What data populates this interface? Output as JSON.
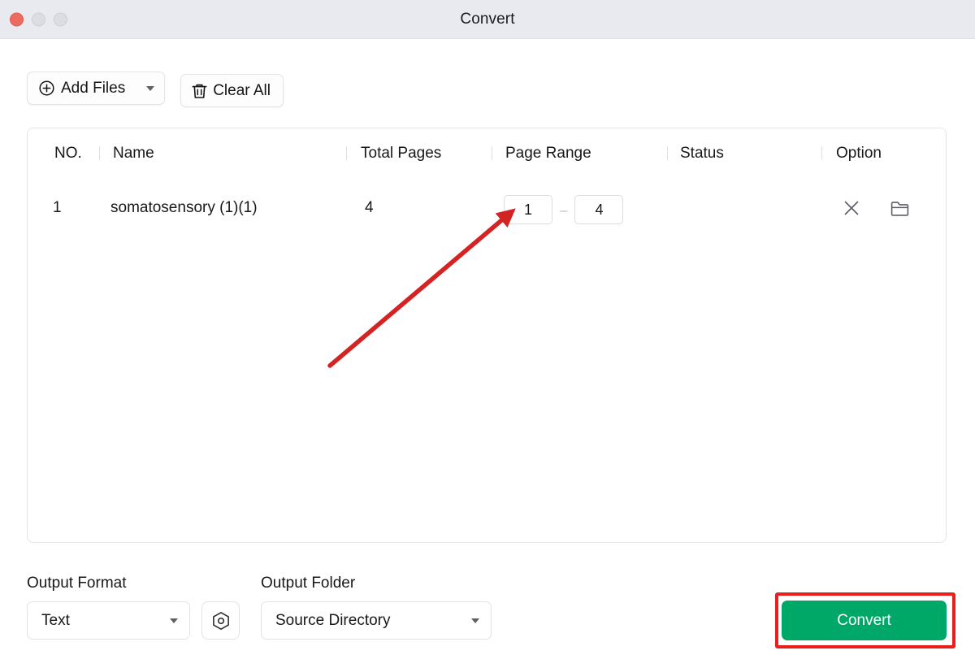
{
  "window": {
    "title": "Convert",
    "traffic_lights": [
      "close",
      "minimize",
      "maximize"
    ]
  },
  "toolbar": {
    "add_files_label": "Add Files",
    "add_files_icon": "plus-circle-icon",
    "add_files_caret": "chevron-down-icon",
    "clear_all_label": "Clear All",
    "clear_all_icon": "trash-icon"
  },
  "file_table": {
    "columns": [
      "NO.",
      "Name",
      "Total Pages",
      "Page Range",
      "Status",
      "Option"
    ],
    "rows": [
      {
        "no": "1",
        "name": "somatosensory (1)(1)",
        "total_pages": "4",
        "page_range_from": "1",
        "page_range_to": "4",
        "page_range_separator": "–",
        "status": "",
        "actions": [
          "close-icon",
          "folder-icon"
        ]
      }
    ]
  },
  "bottom": {
    "output_format_label": "Output Format",
    "output_format_value": "Text",
    "settings_icon": "settings-hex-icon",
    "output_folder_label": "Output Folder",
    "output_folder_value": "Source Directory",
    "convert_label": "Convert"
  },
  "annotations": {
    "arrow_color": "#d32323",
    "highlight_color": "#e81f1f",
    "arrow_from": "405,450",
    "arrow_to": "634,256"
  },
  "colors": {
    "accent_green": "#00a868",
    "titlebar_bg": "#e8eaf0",
    "highlight_red": "#e81f1f",
    "close_dot": "#ec6a5e"
  }
}
